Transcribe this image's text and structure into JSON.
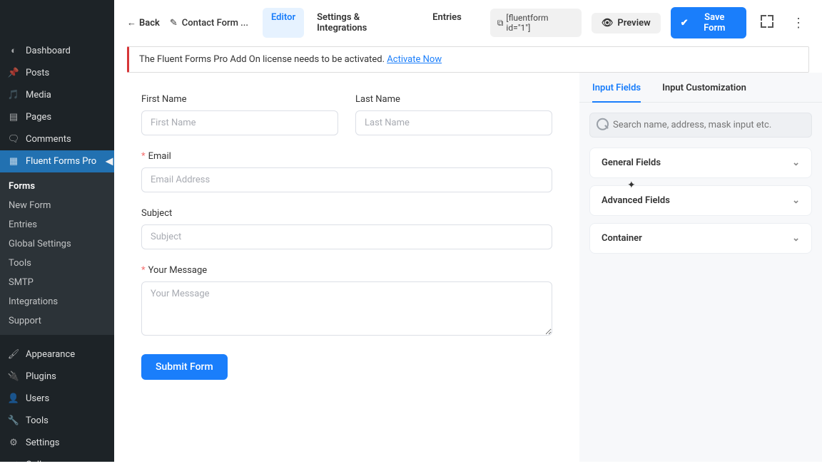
{
  "sidebar": {
    "items": [
      {
        "label": "Dashboard",
        "icon": "⚙"
      },
      {
        "label": "Posts",
        "icon": "✎"
      },
      {
        "label": "Media",
        "icon": "🖼"
      },
      {
        "label": "Pages",
        "icon": "📄"
      },
      {
        "label": "Comments",
        "icon": "💬"
      },
      {
        "label": "Fluent Forms Pro",
        "icon": "▦",
        "active": true
      }
    ],
    "submenu": [
      {
        "label": "Forms",
        "active": true
      },
      {
        "label": "New Form"
      },
      {
        "label": "Entries"
      },
      {
        "label": "Global Settings"
      },
      {
        "label": "Tools"
      },
      {
        "label": "SMTP"
      },
      {
        "label": "Integrations"
      },
      {
        "label": "Support"
      }
    ],
    "items2": [
      {
        "label": "Appearance",
        "icon": "✦"
      },
      {
        "label": "Plugins",
        "icon": "🔌"
      },
      {
        "label": "Users",
        "icon": "👤"
      },
      {
        "label": "Tools",
        "icon": "🔧"
      },
      {
        "label": "Settings",
        "icon": "⚙"
      }
    ],
    "collapse": "Collapse menu"
  },
  "topbar": {
    "back": "Back",
    "form_name": "Contact Form ...",
    "tabs": [
      {
        "label": "Editor",
        "active": true
      },
      {
        "label": "Settings & Integrations"
      },
      {
        "label": "Entries"
      }
    ],
    "shortcode": "[fluentform id=\"1\"]",
    "preview": "Preview",
    "save": "Save Form"
  },
  "notice": {
    "text": "The Fluent Forms Pro Add On license needs to be activated. ",
    "link": "Activate Now"
  },
  "form": {
    "fields": {
      "first_name": {
        "label": "First Name",
        "placeholder": "First Name"
      },
      "last_name": {
        "label": "Last Name",
        "placeholder": "Last Name"
      },
      "email": {
        "label": "Email",
        "placeholder": "Email Address",
        "required": true
      },
      "subject": {
        "label": "Subject",
        "placeholder": "Subject"
      },
      "message": {
        "label": "Your Message",
        "placeholder": "Your Message",
        "required": true
      }
    },
    "submit": "Submit Form"
  },
  "panel": {
    "tabs": [
      {
        "label": "Input Fields",
        "active": true
      },
      {
        "label": "Input Customization"
      }
    ],
    "search_placeholder": "Search name, address, mask input etc.",
    "groups": [
      {
        "label": "General Fields"
      },
      {
        "label": "Advanced Fields"
      },
      {
        "label": "Container"
      }
    ]
  }
}
